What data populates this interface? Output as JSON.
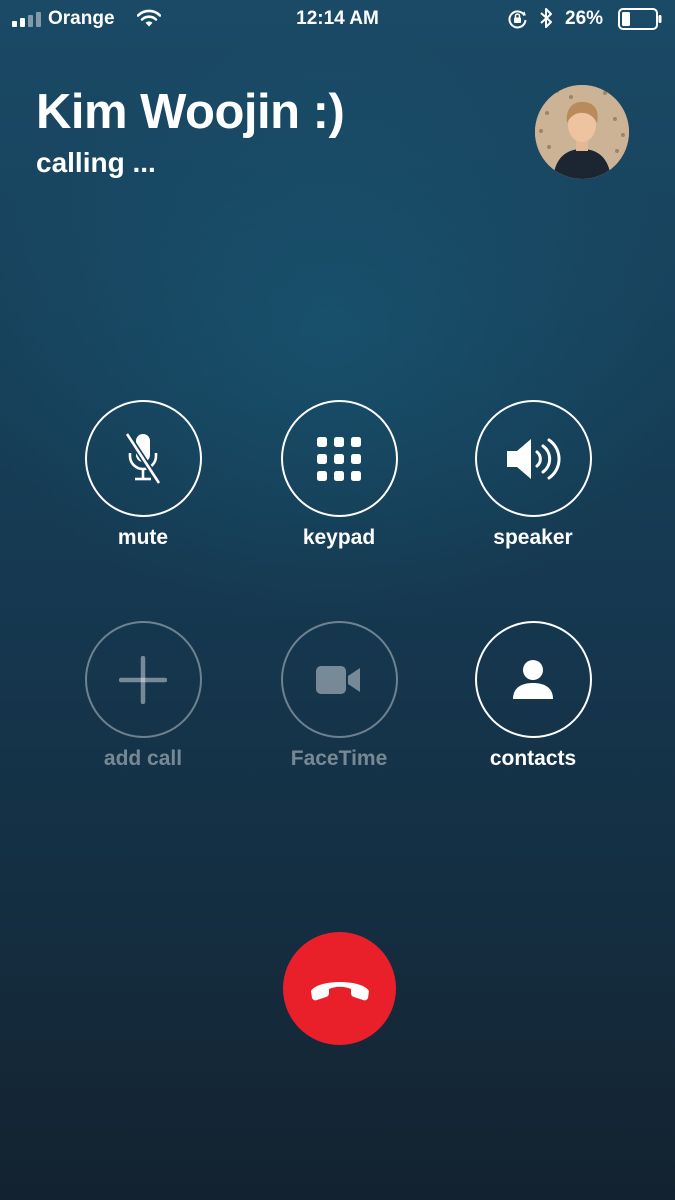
{
  "status_bar": {
    "carrier": "Orange",
    "time": "12:14 AM",
    "battery_percent": "26%",
    "battery_level": 0.26,
    "signal_bars": 2,
    "icons": [
      "signal-icon",
      "wifi-icon",
      "rotation-lock-icon",
      "bluetooth-icon",
      "battery-icon"
    ]
  },
  "call": {
    "contact_name": "Kim Woojin :)",
    "status": "calling ..."
  },
  "controls": {
    "mute": {
      "label": "mute",
      "icon": "microphone-muted-icon",
      "enabled": true
    },
    "keypad": {
      "label": "keypad",
      "icon": "keypad-icon",
      "enabled": true
    },
    "speaker": {
      "label": "speaker",
      "icon": "speaker-icon",
      "enabled": true
    },
    "add_call": {
      "label": "add call",
      "icon": "plus-icon",
      "enabled": false
    },
    "facetime": {
      "label": "FaceTime",
      "icon": "video-camera-icon",
      "enabled": false
    },
    "contacts": {
      "label": "contacts",
      "icon": "person-icon",
      "enabled": true
    }
  },
  "end_call": {
    "icon": "hang-up-phone-icon",
    "color": "#e9202a"
  },
  "colors": {
    "background_top": "#1a4a66",
    "background_bottom": "#13222f",
    "text": "#ffffff",
    "end_call": "#e9202a"
  }
}
